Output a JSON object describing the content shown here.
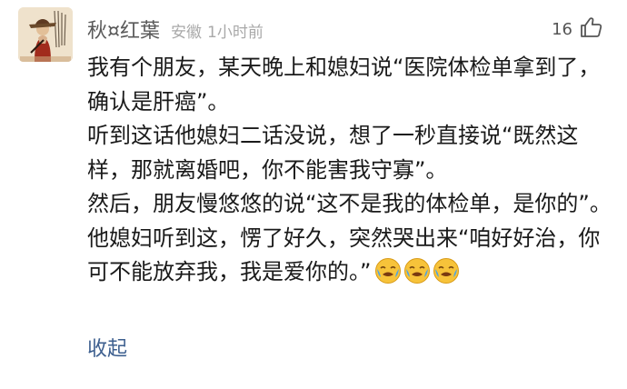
{
  "comment": {
    "username": "秋¤红葉",
    "location": "安徽",
    "time": "1小时前",
    "likes": "16",
    "paragraphs": [
      "我有个朋友，某天晚上和媳妇说“医院体检单拿到了，确认是肝癌”。",
      "听到这话他媳妇二话没说，想了一秒直接说“既然这样，那就离婚吧，你不能害我守寡”。",
      "然后，朋友慢悠悠的说“这不是我的体检单，是你的”。",
      "他媳妇听到这，愣了好久，突然哭出来“咱好好治，你可不能放弃我，我是爱你的。”"
    ],
    "trailing_emojis": [
      "crying-face-emoji",
      "crying-face-emoji",
      "crying-face-emoji"
    ],
    "collapse_label": "收起"
  },
  "colors": {
    "username": "#5a5a5a",
    "meta": "#a9a9a9",
    "body": "#1a1a1a",
    "link": "#3d5f8f",
    "emoji_face": "#f7c33a"
  }
}
